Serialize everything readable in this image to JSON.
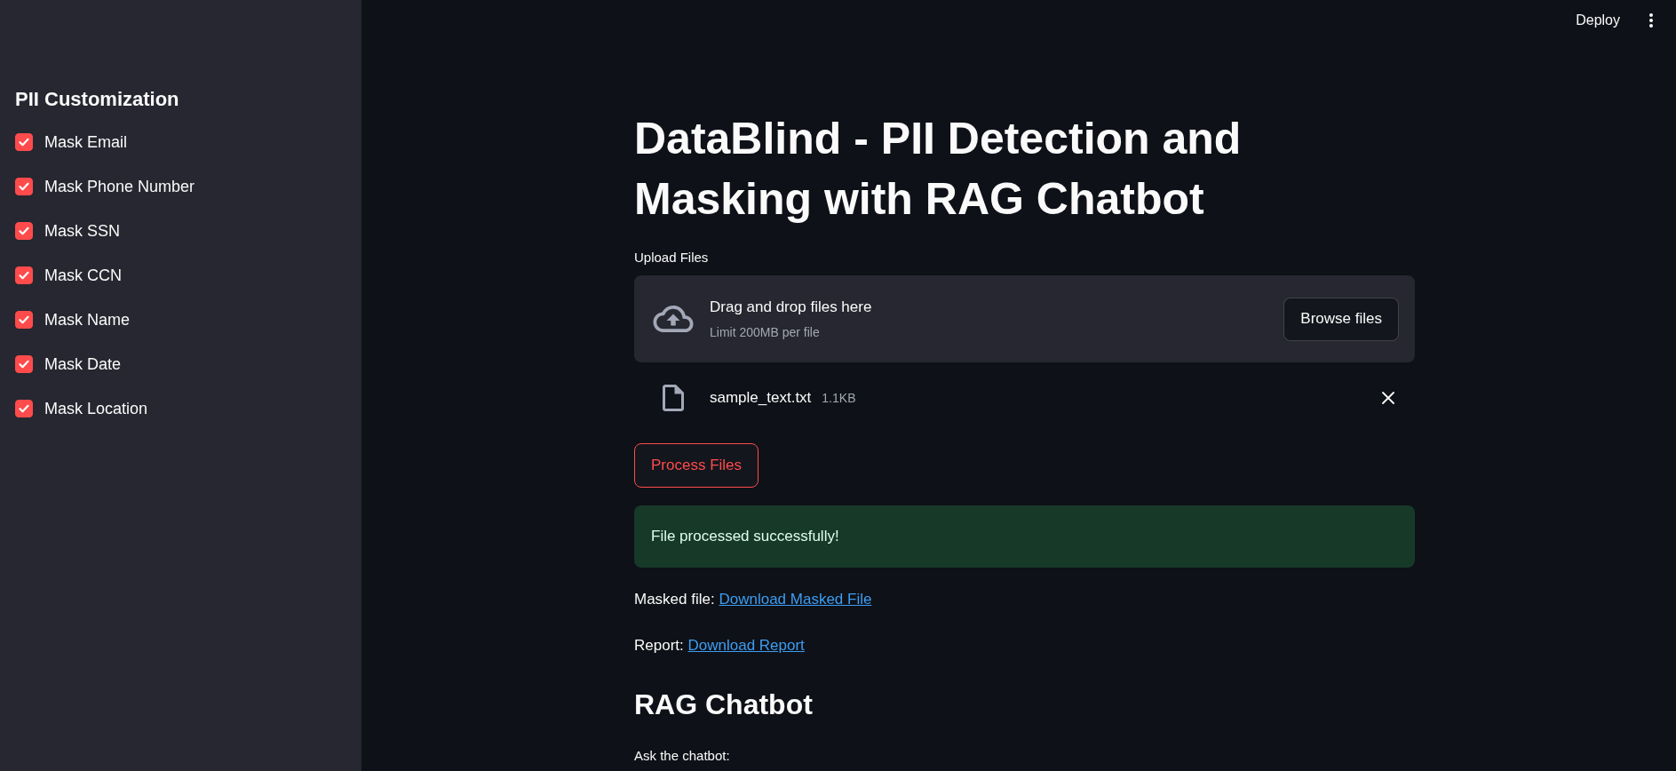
{
  "toolbar": {
    "deploy": "Deploy"
  },
  "sidebar": {
    "title": "PII Customization",
    "options": [
      {
        "label": "Mask Email",
        "checked": true
      },
      {
        "label": "Mask Phone Number",
        "checked": true
      },
      {
        "label": "Mask SSN",
        "checked": true
      },
      {
        "label": "Mask CCN",
        "checked": true
      },
      {
        "label": "Mask Name",
        "checked": true
      },
      {
        "label": "Mask Date",
        "checked": true
      },
      {
        "label": "Mask Location",
        "checked": true
      }
    ]
  },
  "main": {
    "title": "DataBlind - PII Detection and Masking with RAG Chatbot",
    "uploader": {
      "label": "Upload Files",
      "instructions": "Drag and drop files here",
      "limit": "Limit 200MB per file",
      "browse_button": "Browse files",
      "files": [
        {
          "name": "sample_text.txt",
          "size": "1.1KB"
        }
      ]
    },
    "process_button": {
      "label": "Process Files",
      "focused": true
    },
    "alert": {
      "kind": "success",
      "text": "File processed successfully!"
    },
    "downloads": [
      {
        "prefix": "Masked file:",
        "link": "Download Masked File"
      },
      {
        "prefix": "Report:",
        "link": "Download Report"
      }
    ],
    "chatbot": {
      "title": "RAG Chatbot",
      "input_label": "Ask the chatbot:"
    }
  }
}
